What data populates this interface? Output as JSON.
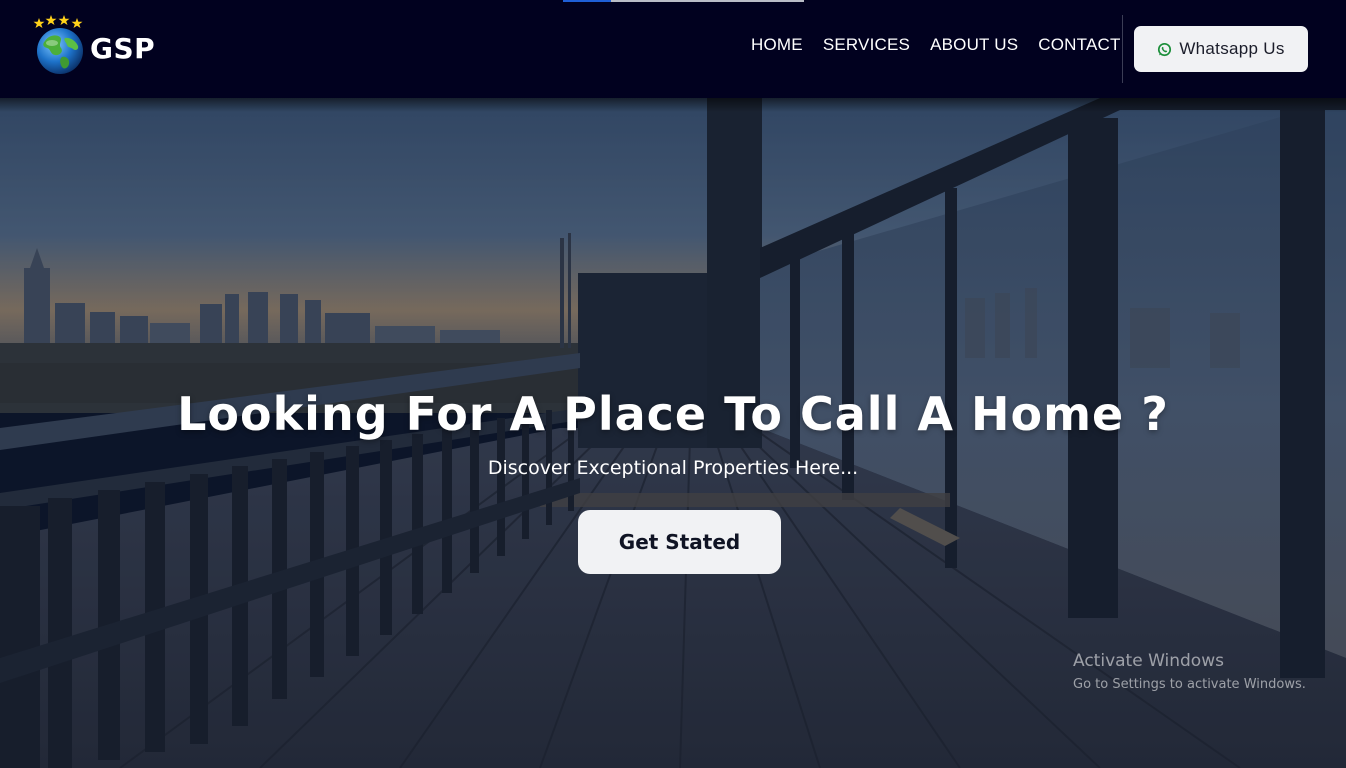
{
  "header": {
    "logo_text": "GSP",
    "progress": 0.2,
    "nav": [
      {
        "label": "HOME"
      },
      {
        "label": "SERVICES"
      },
      {
        "label": "ABOUT US"
      },
      {
        "label": "CONTACT"
      }
    ],
    "whatsapp_button": {
      "label": "Whatsapp Us",
      "icon": "whatsapp-icon",
      "icon_color": "#1b8f3a"
    }
  },
  "hero": {
    "title": "Looking For A Place To Call A Home ?",
    "subtitle": "Discover Exceptional Properties Here...",
    "cta_label": "Get Stated",
    "background": "balcony-city-skyline-photo"
  },
  "watermark": {
    "title": "Activate Windows",
    "subtitle": "Go to Settings to activate Windows."
  },
  "colors": {
    "header_bg": "#01011f",
    "button_bg": "#f1f2f4",
    "text": "#ffffff"
  }
}
